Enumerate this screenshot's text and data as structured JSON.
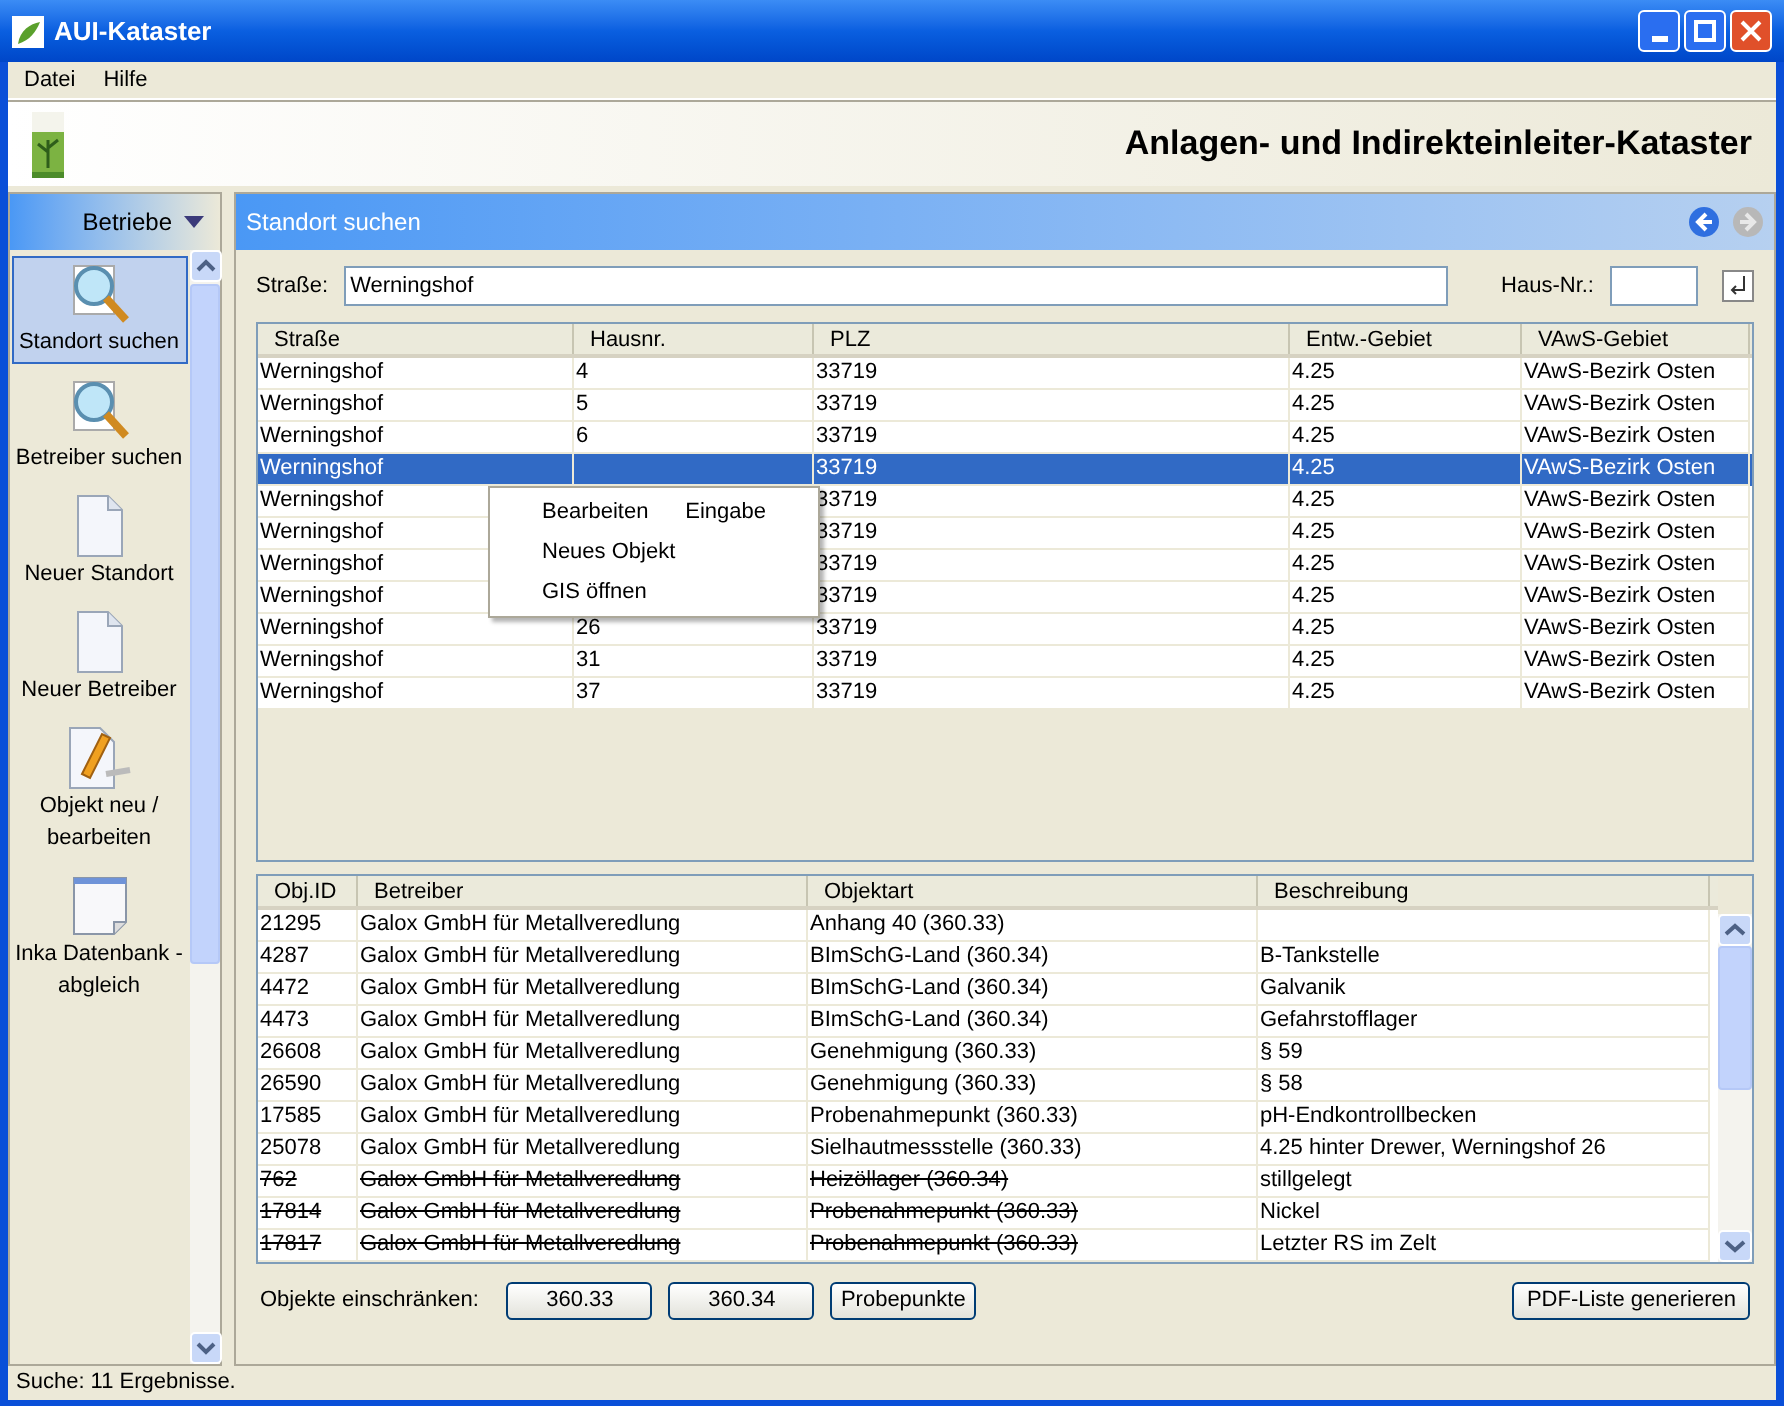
{
  "window": {
    "title": "AUI-Kataster"
  },
  "menu": [
    "Datei",
    "Hilfe"
  ],
  "header": {
    "title": "Anlagen- und Indirekteinleiter-Kataster"
  },
  "sidebar": {
    "group": "Betriebe",
    "items": [
      {
        "label": "Standort suchen",
        "kind": "search",
        "selected": true
      },
      {
        "label": "Betreiber suchen",
        "kind": "search",
        "selected": false
      },
      {
        "label": "Neuer Standort",
        "kind": "document",
        "selected": false
      },
      {
        "label": "Neuer Betreiber",
        "kind": "document",
        "selected": false
      },
      {
        "label": "Objekt neu / bearbeiten",
        "kind": "edit",
        "selected": false
      },
      {
        "label": "Inka Datenbank - abgleich",
        "kind": "sync",
        "selected": false
      }
    ]
  },
  "panel": {
    "title": "Standort suchen",
    "street": {
      "label": "Straße:",
      "value": "Werningshof"
    },
    "house_no": {
      "label": "Haus-Nr.:"
    },
    "sites": {
      "columns": [
        "Straße",
        "Hausnr.",
        "PLZ",
        "Entw.-Gebiet",
        "VAwS-Gebiet"
      ],
      "rows": [
        {
          "cells": [
            "Werningshof",
            "4",
            "33719",
            "4.25",
            "VAwS-Bezirk Osten"
          ],
          "selected": false
        },
        {
          "cells": [
            "Werningshof",
            "5",
            "33719",
            "4.25",
            "VAwS-Bezirk Osten"
          ],
          "selected": false
        },
        {
          "cells": [
            "Werningshof",
            "6",
            "33719",
            "4.25",
            "VAwS-Bezirk Osten"
          ],
          "selected": false
        },
        {
          "cells": [
            "Werningshof",
            "",
            "33719",
            "4.25",
            "VAwS-Bezirk Osten"
          ],
          "selected": true
        },
        {
          "cells": [
            "Werningshof",
            "",
            "33719",
            "4.25",
            "VAwS-Bezirk Osten"
          ],
          "selected": false
        },
        {
          "cells": [
            "Werningshof",
            "",
            "33719",
            "4.25",
            "VAwS-Bezirk Osten"
          ],
          "selected": false
        },
        {
          "cells": [
            "Werningshof",
            "",
            "33719",
            "4.25",
            "VAwS-Bezirk Osten"
          ],
          "selected": false
        },
        {
          "cells": [
            "Werningshof",
            "",
            "33719",
            "4.25",
            "VAwS-Bezirk Osten"
          ],
          "selected": false
        },
        {
          "cells": [
            "Werningshof",
            "26",
            "33719",
            "4.25",
            "VAwS-Bezirk Osten"
          ],
          "selected": false
        },
        {
          "cells": [
            "Werningshof",
            "31",
            "33719",
            "4.25",
            "VAwS-Bezirk Osten"
          ],
          "selected": false
        },
        {
          "cells": [
            "Werningshof",
            "37",
            "33719",
            "4.25",
            "VAwS-Bezirk Osten"
          ],
          "selected": false
        }
      ]
    },
    "context_menu": [
      {
        "label": "Bearbeiten",
        "shortcut": "Eingabe"
      },
      {
        "label": "Neues Objekt"
      },
      {
        "label": "GIS öffnen"
      }
    ],
    "objects": {
      "columns": [
        "Obj.ID",
        "Betreiber",
        "Objektart",
        "Beschreibung"
      ],
      "rows": [
        {
          "cells": [
            "21295",
            "Galox GmbH für Metallveredlung",
            "Anhang 40 (360.33)",
            ""
          ],
          "deleted": false
        },
        {
          "cells": [
            "4287",
            "Galox GmbH für Metallveredlung",
            "BImSchG-Land (360.34)",
            "B-Tankstelle"
          ],
          "deleted": false
        },
        {
          "cells": [
            "4472",
            "Galox GmbH für Metallveredlung",
            "BImSchG-Land (360.34)",
            "Galvanik"
          ],
          "deleted": false
        },
        {
          "cells": [
            "4473",
            "Galox GmbH für Metallveredlung",
            "BImSchG-Land (360.34)",
            "Gefahrstofflager"
          ],
          "deleted": false
        },
        {
          "cells": [
            "26608",
            "Galox GmbH für Metallveredlung",
            "Genehmigung (360.33)",
            "§ 59"
          ],
          "deleted": false
        },
        {
          "cells": [
            "26590",
            "Galox GmbH für Metallveredlung",
            "Genehmigung (360.33)",
            "§ 58"
          ],
          "deleted": false
        },
        {
          "cells": [
            "17585",
            "Galox GmbH für Metallveredlung",
            "Probenahmepunkt (360.33)",
            "pH-Endkontrollbecken"
          ],
          "deleted": false
        },
        {
          "cells": [
            "25078",
            "Galox GmbH für Metallveredlung",
            "Sielhautmessstelle (360.33)",
            "4.25 hinter Drewer, Werningshof 26"
          ],
          "deleted": false
        },
        {
          "cells": [
            "762",
            "Galox GmbH für Metallveredlung",
            "Heizöllager (360.34)",
            "stillgelegt"
          ],
          "deleted": true
        },
        {
          "cells": [
            "17814",
            "Galox GmbH für Metallveredlung",
            "Probenahmepunkt (360.33)",
            "Nickel"
          ],
          "deleted": true
        },
        {
          "cells": [
            "17817",
            "Galox GmbH für Metallveredlung",
            "Probenahmepunkt (360.33)",
            "Letzter RS im Zelt"
          ],
          "deleted": true
        }
      ]
    },
    "filter": {
      "label": "Objekte einschränken:",
      "buttons": [
        "360.33",
        "360.34",
        "Probepunkte"
      ]
    },
    "pdf_button": "PDF-Liste generieren"
  },
  "status_bar": "Suche: 11 Ergebnisse."
}
